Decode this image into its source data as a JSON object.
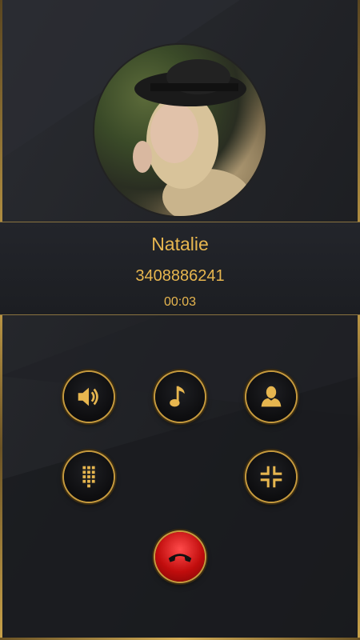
{
  "caller": {
    "name": "Natalie",
    "number": "3408886241",
    "duration": "00:03"
  },
  "controls": [
    {
      "name": "speaker-button",
      "icon": "speaker-icon"
    },
    {
      "name": "music-button",
      "icon": "music-note-icon"
    },
    {
      "name": "contact-button",
      "icon": "person-icon"
    },
    {
      "name": "keypad-button",
      "icon": "dialpad-icon"
    },
    {
      "name": "minimize-button",
      "icon": "collapse-icon"
    },
    {
      "name": "end-call-button",
      "icon": "phone-hangup-icon"
    }
  ],
  "colors": {
    "accent": "#e7b64f",
    "end_call": "#d81a1a"
  }
}
